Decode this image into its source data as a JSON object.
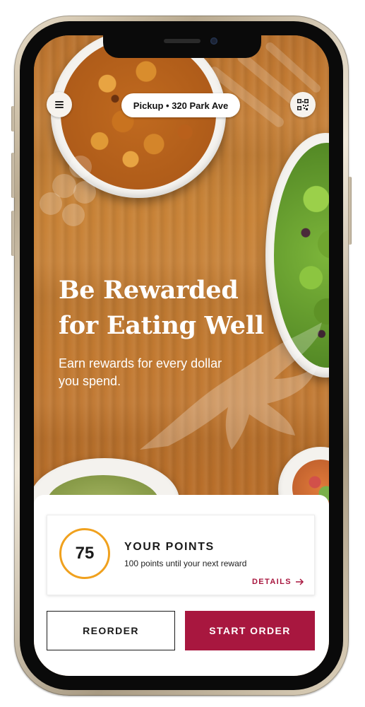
{
  "header": {
    "menu_icon": "hamburger-menu-icon",
    "pickup_label": "Pickup • 320 Park Ave",
    "qr_icon": "qr-code-icon"
  },
  "hero": {
    "headline_line1": "Be Rewarded",
    "headline_line2": "for Eating Well",
    "subtext": "Earn rewards for every dollar you spend."
  },
  "rewards": {
    "points": "75",
    "title": "YOUR POINTS",
    "subtitle": "100 points until your next reward",
    "details_label": "DETAILS",
    "details_icon": "arrow-right-icon",
    "ring_color": "#f0a11e"
  },
  "actions": {
    "reorder_label": "REORDER",
    "start_order_label": "START ORDER",
    "accent_color": "#a8173f"
  }
}
